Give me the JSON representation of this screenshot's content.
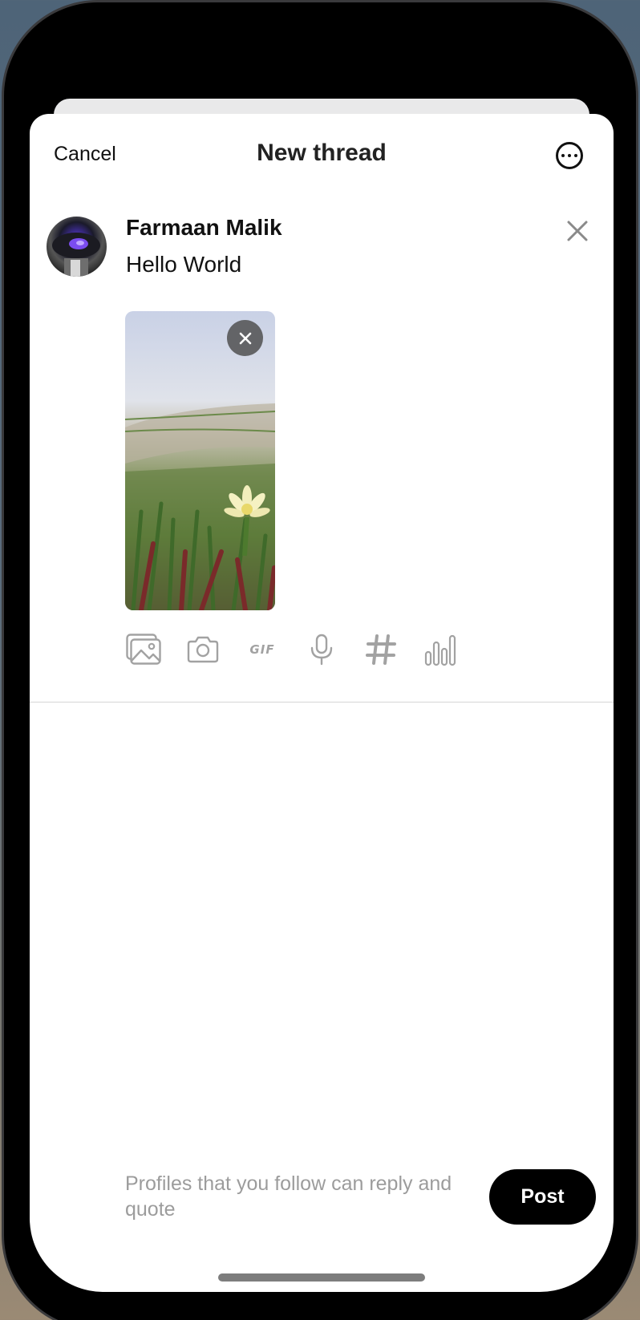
{
  "header": {
    "cancel_label": "Cancel",
    "title": "New thread"
  },
  "composer": {
    "user_name": "Farmaan Malik",
    "post_text": "Hello World"
  },
  "toolbar": {
    "gif_label": "GIF",
    "icons": [
      "image-gallery-icon",
      "camera-icon",
      "gif-icon",
      "microphone-icon",
      "hashtag-icon",
      "poll-icon"
    ]
  },
  "footer": {
    "reply_setting": " Profiles that you follow can reply and quote",
    "post_label": "Post"
  }
}
